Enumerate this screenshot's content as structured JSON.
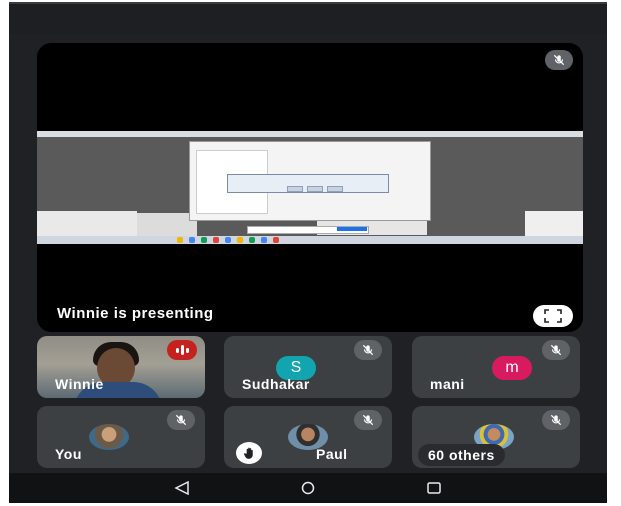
{
  "stage": {
    "presenting_label": "Winnie is presenting",
    "icons": {
      "mic": "mic-off-icon",
      "fullscreen": "fullscreen-icon"
    }
  },
  "participants": [
    {
      "name": "Winnie",
      "type": "video",
      "speaking": true
    },
    {
      "name": "Sudhakar",
      "initial": "S",
      "avatar_color": "#12a4af",
      "muted": true
    },
    {
      "name": "mani",
      "initial": "m",
      "avatar_color": "#d81b60",
      "muted": true
    },
    {
      "name": "You",
      "type": "photo",
      "muted": true
    },
    {
      "name": "Paul",
      "type": "photo",
      "muted": true,
      "hand_raised": true
    },
    {
      "name": "60 others",
      "type": "photo",
      "muted": true
    }
  ],
  "navbar": {
    "icons": [
      "back-icon",
      "home-icon",
      "recents-icon"
    ]
  },
  "colors": {
    "background": "#202124",
    "tile": "#3c4043",
    "accent_red": "#c5221f"
  }
}
